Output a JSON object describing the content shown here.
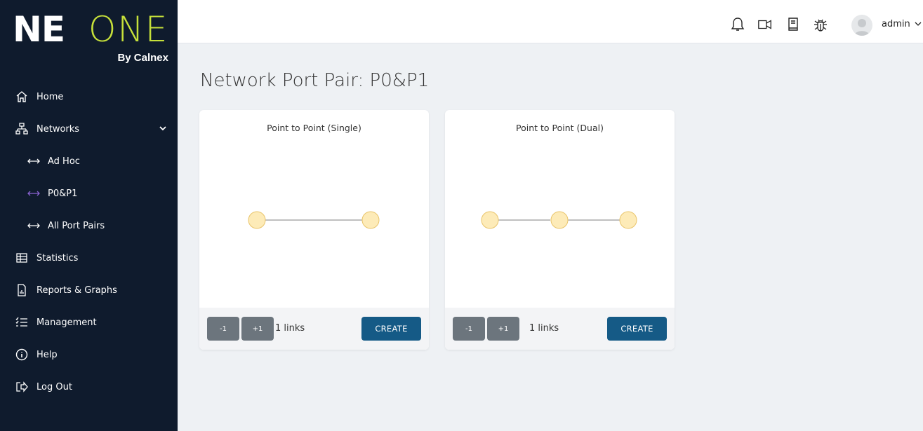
{
  "brand": {
    "logo_left": "NE",
    "logo_right": "ONE",
    "tagline": "By Calnex"
  },
  "sidebar": {
    "items": [
      {
        "label": "Home",
        "icon": "home-icon"
      },
      {
        "label": "Networks",
        "icon": "network-icon",
        "expanded": true
      },
      {
        "label": "Ad Hoc",
        "icon": "arrows-icon"
      },
      {
        "label": "P0&P1",
        "icon": "arrows-icon",
        "active": true
      },
      {
        "label": "All Port Pairs",
        "icon": "arrows-icon"
      },
      {
        "label": "Statistics",
        "icon": "table-icon"
      },
      {
        "label": "Reports & Graphs",
        "icon": "report-icon"
      },
      {
        "label": "Management",
        "icon": "list-icon"
      },
      {
        "label": "Help",
        "icon": "info-icon"
      },
      {
        "label": "Log Out",
        "icon": "logout-icon"
      }
    ]
  },
  "topbar": {
    "icons": [
      "bell-icon",
      "video-icon",
      "book-icon",
      "bug-icon"
    ],
    "user": "admin"
  },
  "main": {
    "title": "Network Port Pair: P0&P1",
    "cards": [
      {
        "title": "Point to Point (Single)",
        "nodes": 2,
        "minus": "-1",
        "plus": "+1",
        "links": "1 links",
        "create": "CREATE"
      },
      {
        "title": "Point to Point (Dual)",
        "nodes": 3,
        "minus": "-1",
        "plus": "+1",
        "links": "1 links",
        "create": "CREATE"
      }
    ]
  },
  "colors": {
    "sidebar_bg": "#0f1b2d",
    "logo_accent": "#c6e03a",
    "active_accent": "#8a63d2",
    "primary_button": "#155a86",
    "step_button": "#6c757d",
    "node_fill": "#fdebb8",
    "node_stroke": "#e9c46a"
  }
}
